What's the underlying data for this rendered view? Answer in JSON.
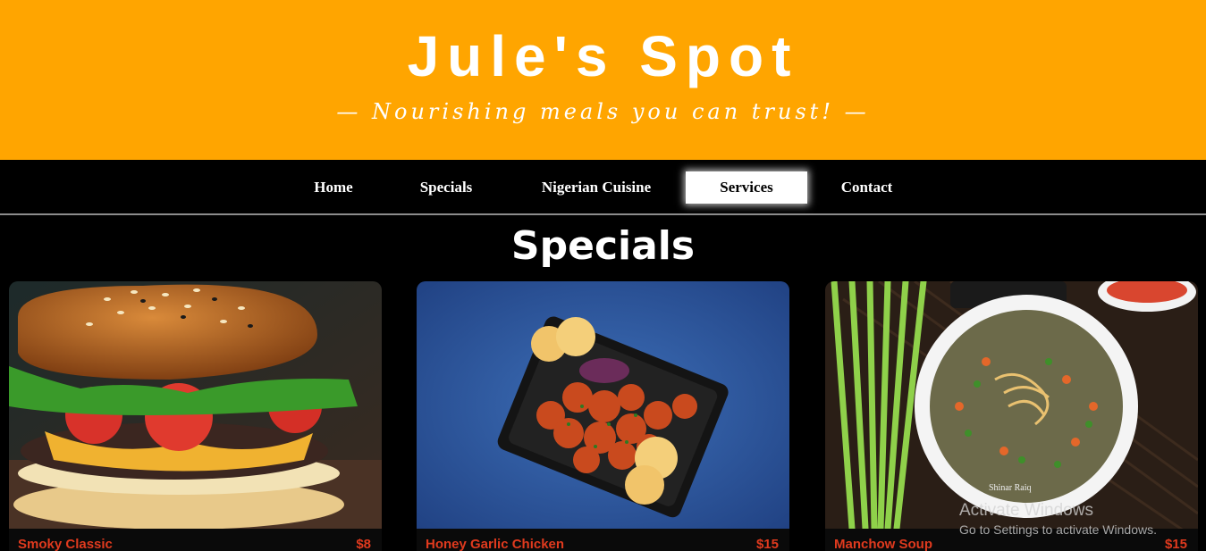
{
  "header": {
    "title": "Jule's Spot",
    "tagline": "— Nourishing meals you can trust! —",
    "bg_color": "#ffa500"
  },
  "nav": {
    "items": [
      {
        "label": "Home",
        "active": false
      },
      {
        "label": "Specials",
        "active": false
      },
      {
        "label": "Nigerian Cuisine",
        "active": false
      },
      {
        "label": "Services",
        "active": true
      },
      {
        "label": "Contact",
        "active": false
      }
    ]
  },
  "section": {
    "title": "Specials"
  },
  "cards": [
    {
      "image": "burger",
      "name": "Smoky Classic",
      "price": "$8"
    },
    {
      "image": "chicken",
      "name": "Honey Garlic Chicken",
      "price": "$15"
    },
    {
      "image": "soup",
      "name": "Manchow Soup",
      "price": "$15"
    }
  ],
  "photo_credit": "Shinar Raiq",
  "watermark": {
    "title": "Activate Windows",
    "subtitle": "Go to Settings to activate Windows."
  },
  "colors": {
    "accent": "#ffa500",
    "price": "#e03a1e",
    "background": "#000000"
  }
}
